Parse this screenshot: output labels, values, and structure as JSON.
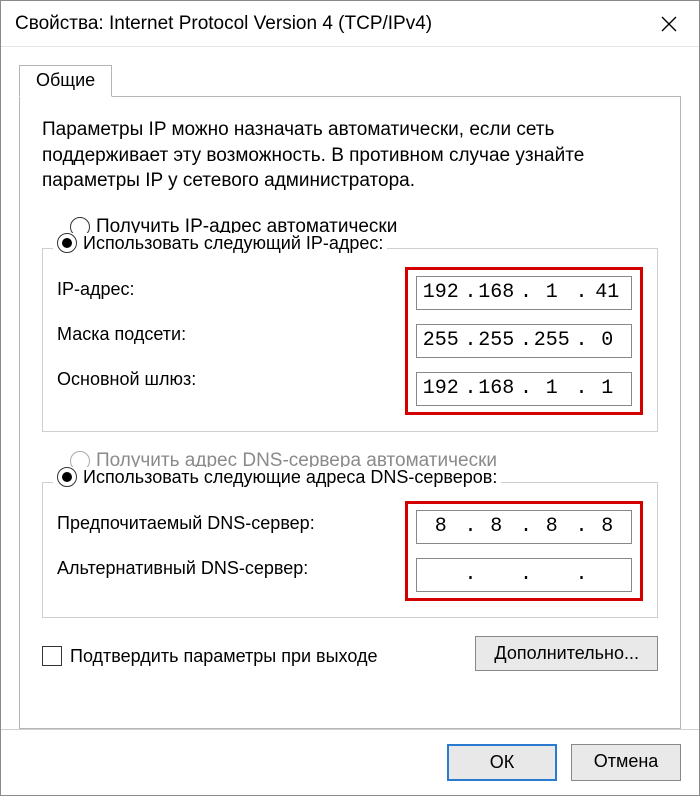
{
  "window": {
    "title": "Свойства: Internet Protocol Version 4 (TCP/IPv4)"
  },
  "tab": {
    "general": "Общие"
  },
  "description": "Параметры IP можно назначать автоматически, если сеть поддерживает эту возможность. В противном случае узнайте параметры IP у сетевого администратора.",
  "ip": {
    "auto": "Получить IP-адрес автоматически",
    "manual": "Использовать следующий IP-адрес:",
    "addr_label": "IP-адрес:",
    "mask_label": "Маска подсети:",
    "gw_label": "Основной шлюз:",
    "addr": {
      "a": "192",
      "b": "168",
      "c": "1",
      "d": "41"
    },
    "mask": {
      "a": "255",
      "b": "255",
      "c": "255",
      "d": "0"
    },
    "gw": {
      "a": "192",
      "b": "168",
      "c": "1",
      "d": "1"
    }
  },
  "dns": {
    "auto": "Получить адрес DNS-сервера автоматически",
    "manual": "Использовать следующие адреса DNS-серверов:",
    "pref_label": "Предпочитаемый DNS-сервер:",
    "alt_label": "Альтернативный DNS-сервер:",
    "pref": {
      "a": "8",
      "b": "8",
      "c": "8",
      "d": "8"
    },
    "alt": {
      "a": "",
      "b": "",
      "c": "",
      "d": ""
    }
  },
  "validate": "Подтвердить параметры при выходе",
  "buttons": {
    "advanced": "Дополнительно...",
    "ok": "ОК",
    "cancel": "Отмена"
  },
  "underline": {
    "ip": "И",
    "mask": "М",
    "gw": "О",
    "pref": "П",
    "alt": "А",
    "adv": "Д",
    "val": "ы"
  }
}
